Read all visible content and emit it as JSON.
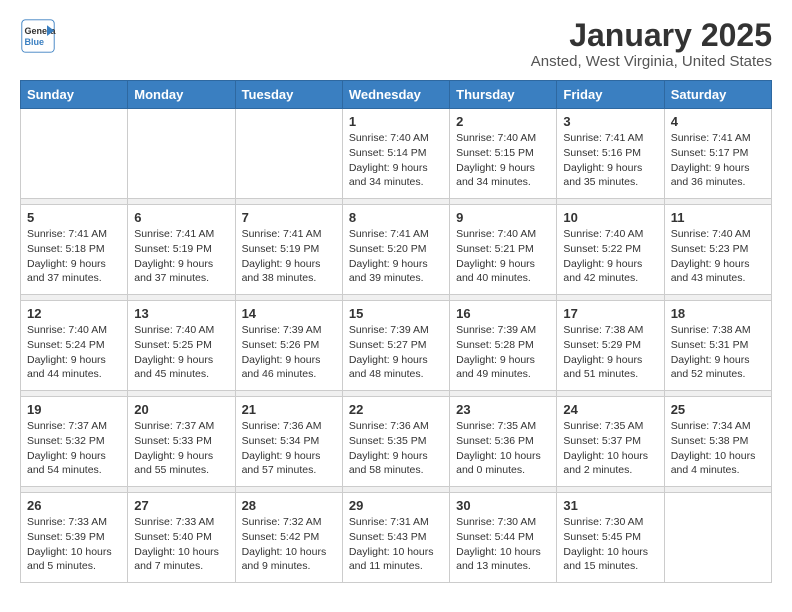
{
  "header": {
    "logo_line1": "General",
    "logo_line2": "Blue",
    "title": "January 2025",
    "subtitle": "Ansted, West Virginia, United States"
  },
  "weekdays": [
    "Sunday",
    "Monday",
    "Tuesday",
    "Wednesday",
    "Thursday",
    "Friday",
    "Saturday"
  ],
  "weeks": [
    [
      {
        "day": "",
        "sunrise": "",
        "sunset": "",
        "daylight": ""
      },
      {
        "day": "",
        "sunrise": "",
        "sunset": "",
        "daylight": ""
      },
      {
        "day": "",
        "sunrise": "",
        "sunset": "",
        "daylight": ""
      },
      {
        "day": "1",
        "sunrise": "Sunrise: 7:40 AM",
        "sunset": "Sunset: 5:14 PM",
        "daylight": "Daylight: 9 hours and 34 minutes."
      },
      {
        "day": "2",
        "sunrise": "Sunrise: 7:40 AM",
        "sunset": "Sunset: 5:15 PM",
        "daylight": "Daylight: 9 hours and 34 minutes."
      },
      {
        "day": "3",
        "sunrise": "Sunrise: 7:41 AM",
        "sunset": "Sunset: 5:16 PM",
        "daylight": "Daylight: 9 hours and 35 minutes."
      },
      {
        "day": "4",
        "sunrise": "Sunrise: 7:41 AM",
        "sunset": "Sunset: 5:17 PM",
        "daylight": "Daylight: 9 hours and 36 minutes."
      }
    ],
    [
      {
        "day": "5",
        "sunrise": "Sunrise: 7:41 AM",
        "sunset": "Sunset: 5:18 PM",
        "daylight": "Daylight: 9 hours and 37 minutes."
      },
      {
        "day": "6",
        "sunrise": "Sunrise: 7:41 AM",
        "sunset": "Sunset: 5:19 PM",
        "daylight": "Daylight: 9 hours and 37 minutes."
      },
      {
        "day": "7",
        "sunrise": "Sunrise: 7:41 AM",
        "sunset": "Sunset: 5:19 PM",
        "daylight": "Daylight: 9 hours and 38 minutes."
      },
      {
        "day": "8",
        "sunrise": "Sunrise: 7:41 AM",
        "sunset": "Sunset: 5:20 PM",
        "daylight": "Daylight: 9 hours and 39 minutes."
      },
      {
        "day": "9",
        "sunrise": "Sunrise: 7:40 AM",
        "sunset": "Sunset: 5:21 PM",
        "daylight": "Daylight: 9 hours and 40 minutes."
      },
      {
        "day": "10",
        "sunrise": "Sunrise: 7:40 AM",
        "sunset": "Sunset: 5:22 PM",
        "daylight": "Daylight: 9 hours and 42 minutes."
      },
      {
        "day": "11",
        "sunrise": "Sunrise: 7:40 AM",
        "sunset": "Sunset: 5:23 PM",
        "daylight": "Daylight: 9 hours and 43 minutes."
      }
    ],
    [
      {
        "day": "12",
        "sunrise": "Sunrise: 7:40 AM",
        "sunset": "Sunset: 5:24 PM",
        "daylight": "Daylight: 9 hours and 44 minutes."
      },
      {
        "day": "13",
        "sunrise": "Sunrise: 7:40 AM",
        "sunset": "Sunset: 5:25 PM",
        "daylight": "Daylight: 9 hours and 45 minutes."
      },
      {
        "day": "14",
        "sunrise": "Sunrise: 7:39 AM",
        "sunset": "Sunset: 5:26 PM",
        "daylight": "Daylight: 9 hours and 46 minutes."
      },
      {
        "day": "15",
        "sunrise": "Sunrise: 7:39 AM",
        "sunset": "Sunset: 5:27 PM",
        "daylight": "Daylight: 9 hours and 48 minutes."
      },
      {
        "day": "16",
        "sunrise": "Sunrise: 7:39 AM",
        "sunset": "Sunset: 5:28 PM",
        "daylight": "Daylight: 9 hours and 49 minutes."
      },
      {
        "day": "17",
        "sunrise": "Sunrise: 7:38 AM",
        "sunset": "Sunset: 5:29 PM",
        "daylight": "Daylight: 9 hours and 51 minutes."
      },
      {
        "day": "18",
        "sunrise": "Sunrise: 7:38 AM",
        "sunset": "Sunset: 5:31 PM",
        "daylight": "Daylight: 9 hours and 52 minutes."
      }
    ],
    [
      {
        "day": "19",
        "sunrise": "Sunrise: 7:37 AM",
        "sunset": "Sunset: 5:32 PM",
        "daylight": "Daylight: 9 hours and 54 minutes."
      },
      {
        "day": "20",
        "sunrise": "Sunrise: 7:37 AM",
        "sunset": "Sunset: 5:33 PM",
        "daylight": "Daylight: 9 hours and 55 minutes."
      },
      {
        "day": "21",
        "sunrise": "Sunrise: 7:36 AM",
        "sunset": "Sunset: 5:34 PM",
        "daylight": "Daylight: 9 hours and 57 minutes."
      },
      {
        "day": "22",
        "sunrise": "Sunrise: 7:36 AM",
        "sunset": "Sunset: 5:35 PM",
        "daylight": "Daylight: 9 hours and 58 minutes."
      },
      {
        "day": "23",
        "sunrise": "Sunrise: 7:35 AM",
        "sunset": "Sunset: 5:36 PM",
        "daylight": "Daylight: 10 hours and 0 minutes."
      },
      {
        "day": "24",
        "sunrise": "Sunrise: 7:35 AM",
        "sunset": "Sunset: 5:37 PM",
        "daylight": "Daylight: 10 hours and 2 minutes."
      },
      {
        "day": "25",
        "sunrise": "Sunrise: 7:34 AM",
        "sunset": "Sunset: 5:38 PM",
        "daylight": "Daylight: 10 hours and 4 minutes."
      }
    ],
    [
      {
        "day": "26",
        "sunrise": "Sunrise: 7:33 AM",
        "sunset": "Sunset: 5:39 PM",
        "daylight": "Daylight: 10 hours and 5 minutes."
      },
      {
        "day": "27",
        "sunrise": "Sunrise: 7:33 AM",
        "sunset": "Sunset: 5:40 PM",
        "daylight": "Daylight: 10 hours and 7 minutes."
      },
      {
        "day": "28",
        "sunrise": "Sunrise: 7:32 AM",
        "sunset": "Sunset: 5:42 PM",
        "daylight": "Daylight: 10 hours and 9 minutes."
      },
      {
        "day": "29",
        "sunrise": "Sunrise: 7:31 AM",
        "sunset": "Sunset: 5:43 PM",
        "daylight": "Daylight: 10 hours and 11 minutes."
      },
      {
        "day": "30",
        "sunrise": "Sunrise: 7:30 AM",
        "sunset": "Sunset: 5:44 PM",
        "daylight": "Daylight: 10 hours and 13 minutes."
      },
      {
        "day": "31",
        "sunrise": "Sunrise: 7:30 AM",
        "sunset": "Sunset: 5:45 PM",
        "daylight": "Daylight: 10 hours and 15 minutes."
      },
      {
        "day": "",
        "sunrise": "",
        "sunset": "",
        "daylight": ""
      }
    ]
  ]
}
